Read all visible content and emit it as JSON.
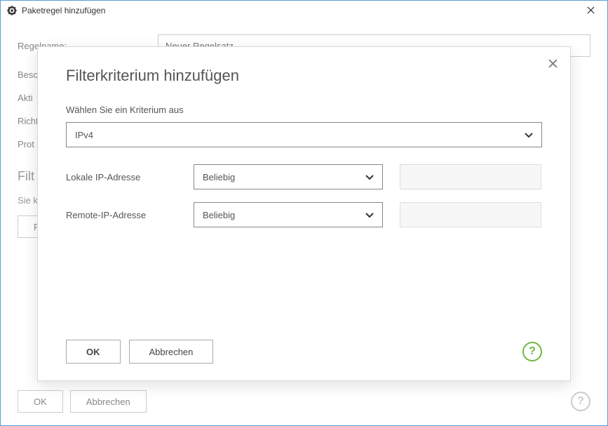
{
  "window": {
    "title": "Paketregel hinzufügen"
  },
  "bg": {
    "labels": {
      "name": "Regelname:",
      "desc": "Besch",
      "action": "Akti",
      "direction": "Richt",
      "protocol": "Prot"
    },
    "rule_name_placeholder": "Neuer Regelsatz",
    "section_filter": "Filt",
    "filter_desc": "Sie k",
    "filter_btn": "F",
    "ok": "OK",
    "cancel": "Abbrechen"
  },
  "modal": {
    "title": "Filterkriterium hinzufügen",
    "choose_label": "Wählen Sie ein Kriterium aus",
    "criterion_value": "IPv4",
    "local_ip_label": "Lokale IP-Adresse",
    "local_ip_value": "Beliebig",
    "remote_ip_label": "Remote-IP-Adresse",
    "remote_ip_value": "Beliebig",
    "ok": "OK",
    "cancel": "Abbrechen"
  }
}
